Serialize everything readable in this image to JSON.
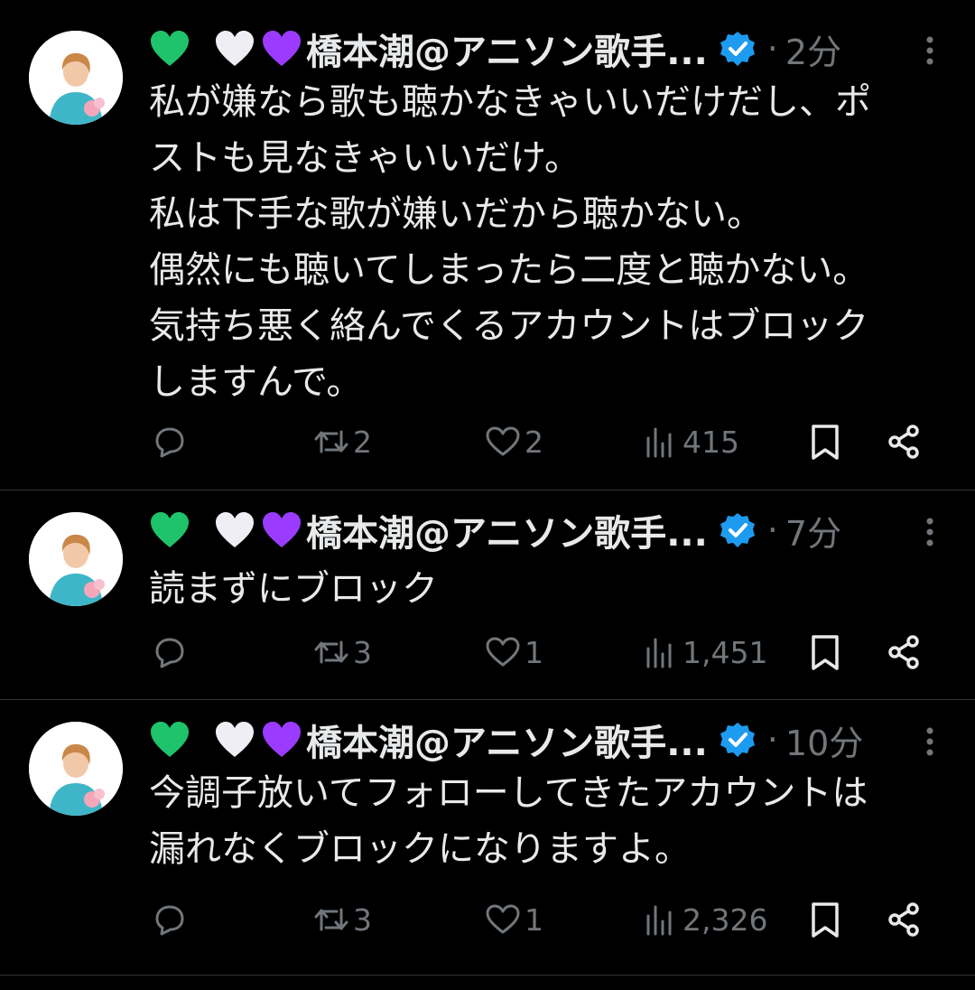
{
  "colors": {
    "background": "#000000",
    "text_primary": "#e7e9ea",
    "text_secondary": "#71767b",
    "divider": "#2f3336",
    "verified_blue": "#1d9bf0",
    "heart_green": "#1fc36b",
    "heart_white": "#eeeef4",
    "heart_purple": "#9b3bff"
  },
  "tweets": [
    {
      "name": "橋本潮@アニソン歌手...",
      "hearts": [
        "green-heart",
        "white-heart",
        "purple-heart"
      ],
      "verified": true,
      "dot": "·",
      "time": "2分",
      "lines": [
        "私が嫌なら歌も聴かなきゃいいだけだし、ポ",
        "ストも見なきゃいいだけ。",
        "私は下手な歌が嫌いだから聴かない。",
        "偶然にも聴いてしまったら二度と聴かない。",
        "気持ち悪く絡んでくるアカウントはブロック",
        "しますんで。"
      ],
      "replies": "",
      "reposts": "2",
      "likes": "2",
      "views": "415"
    },
    {
      "name": "橋本潮@アニソン歌手...",
      "hearts": [
        "green-heart",
        "white-heart",
        "purple-heart"
      ],
      "verified": true,
      "dot": "·",
      "time": "7分",
      "lines": [
        "読まずにブロック"
      ],
      "replies": "",
      "reposts": "3",
      "likes": "1",
      "views": "1,451"
    },
    {
      "name": "橋本潮@アニソン歌手...",
      "hearts": [
        "green-heart",
        "white-heart",
        "purple-heart"
      ],
      "verified": true,
      "dot": "·",
      "time": "10分",
      "lines": [
        "今調子放いてフォローしてきたアカウントは",
        "漏れなくブロックになりますよ。"
      ],
      "replies": "",
      "reposts": "3",
      "likes": "1",
      "views": "2,326"
    }
  ]
}
